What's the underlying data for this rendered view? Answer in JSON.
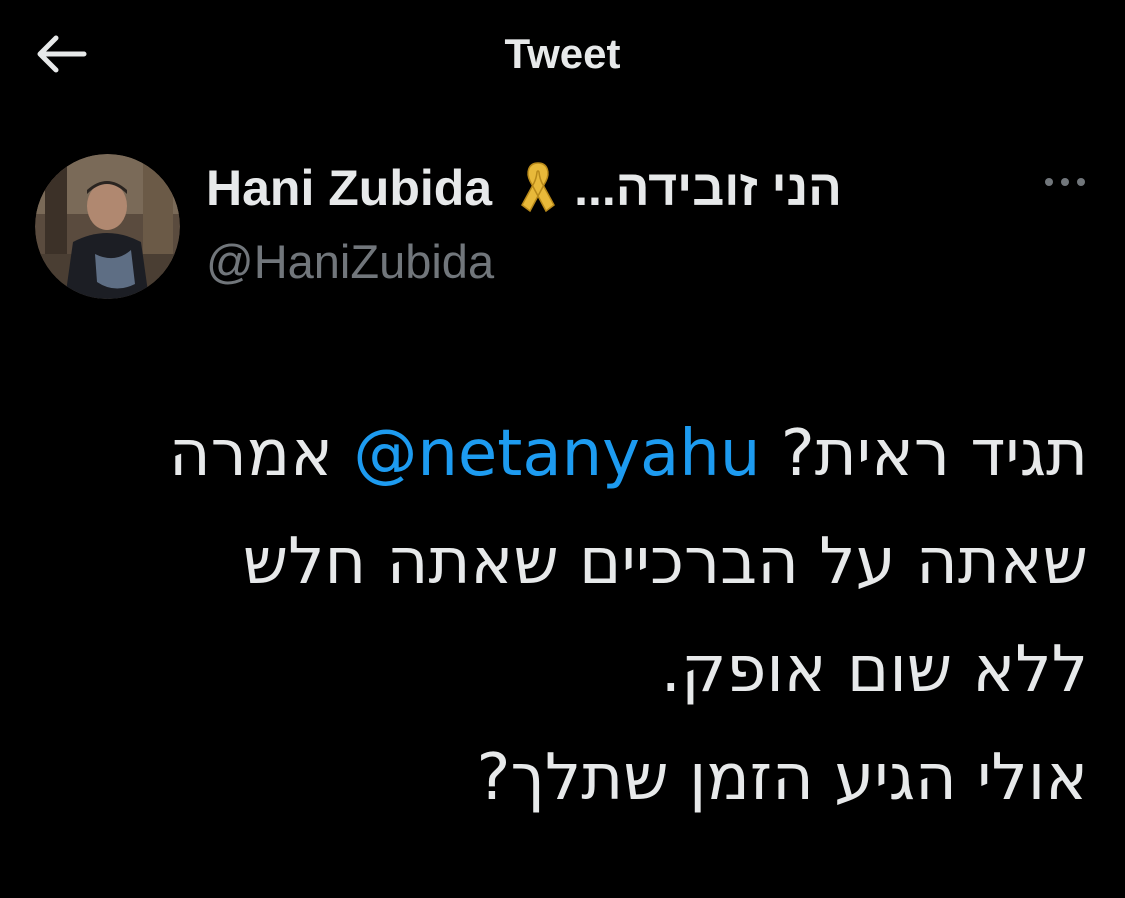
{
  "header": {
    "title": "Tweet",
    "back_icon": "arrow-left-icon"
  },
  "author": {
    "display_name": "Hani Zubida",
    "badge_icon": "yellow-ribbon-icon",
    "badge_color": "#e8b93a",
    "hebrew_name": "הני זובידה...",
    "handle": "@HaniZubida",
    "more_icon": "more-dots-icon"
  },
  "tweet": {
    "line1_pre": "תגיד ראית?",
    "mention": "@netanyahu",
    "line1_post": "אמרה",
    "line2": "שאתה על הברכיים שאתה חלש",
    "line3": "ללא שום אופק.",
    "line4": "אולי הגיע הזמן שתלך?"
  },
  "colors": {
    "background": "#000000",
    "text": "#e7e9ea",
    "secondary_text": "#71767b",
    "link": "#1d9bf0"
  }
}
